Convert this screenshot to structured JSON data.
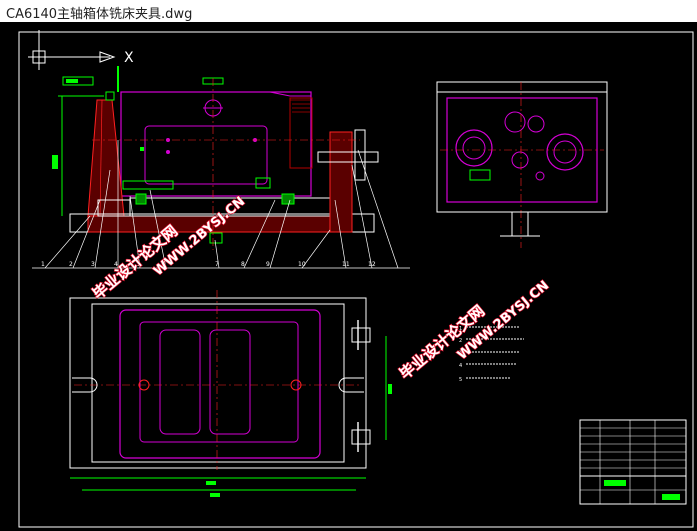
{
  "window": {
    "title": "CA6140主轴箱体铣床夹具.dwg"
  },
  "drawing": {
    "axis_label": "X",
    "balloons": [
      "1",
      "2",
      "3",
      "4",
      "5",
      "6",
      "7",
      "8",
      "9",
      "10",
      "11",
      "12"
    ],
    "notes": [
      "1",
      "2",
      "3",
      "4",
      "5"
    ],
    "watermarks": {
      "cn": "毕业设计论文网",
      "url": "WWW.2BYSJ.CN"
    }
  },
  "colors": {
    "background": "#000000",
    "frame": "#ffffff",
    "part": "#d500d5",
    "fixture": "#00ff00",
    "section": "#b40000",
    "centerline": "#ff2020",
    "watermark": "#e8112d"
  }
}
